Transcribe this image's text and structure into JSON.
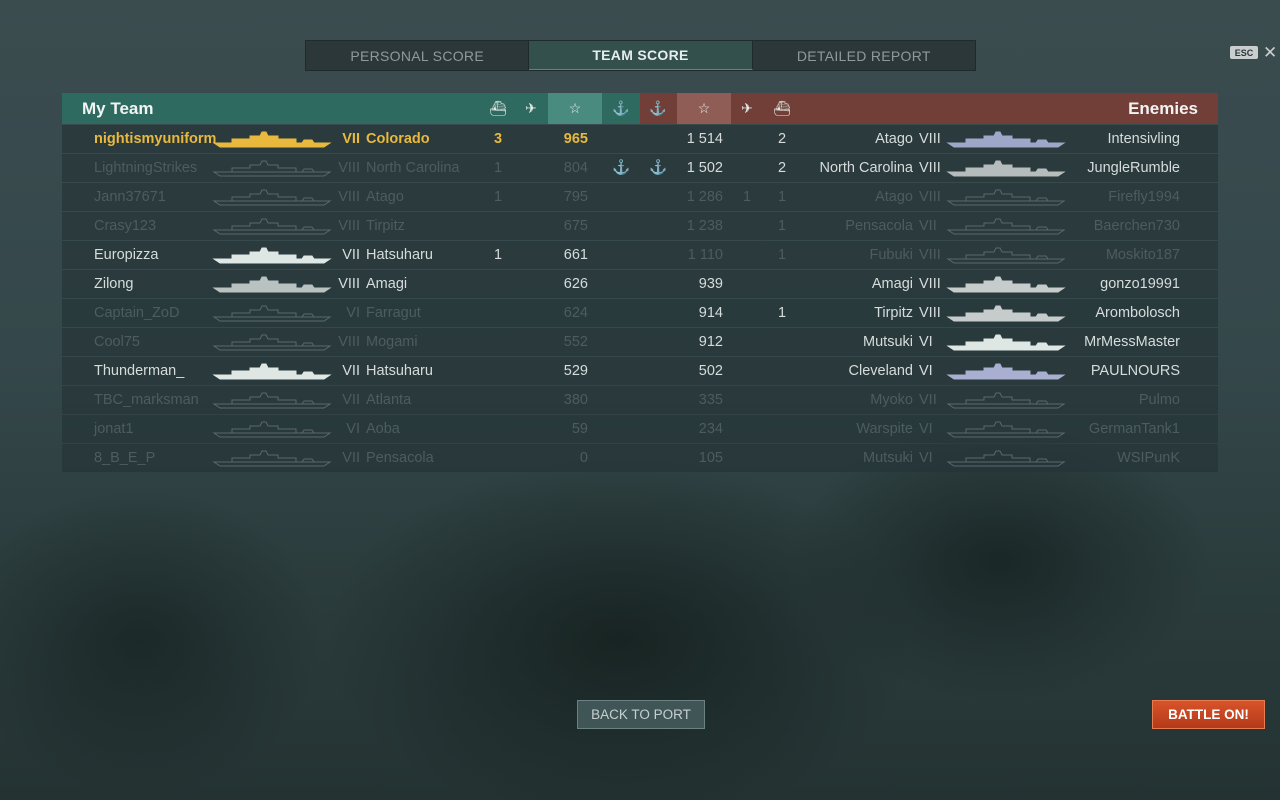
{
  "tabs": [
    "PERSONAL SCORE",
    "TEAM SCORE",
    "DETAILED REPORT"
  ],
  "active_tab": "TEAM SCORE",
  "esc_label": "ESC",
  "close_glyph": "✕",
  "my_team": {
    "title": "My Team",
    "header_icons": [
      "ship-sunk-icon",
      "planes-destroyed-icon",
      "star-icon",
      "anchor-icon"
    ],
    "header_glyphs": {
      "ship": "⛴",
      "planes": "✈",
      "star": "☆",
      "anchor": "⚓"
    },
    "sorted_column": "star",
    "rows": [
      {
        "player": "nightismyuniform",
        "tier": "VII",
        "ship": "Colorado",
        "kills": "3",
        "planes": "",
        "score": "965",
        "base": "",
        "state": "me",
        "ship_color": "#e8b93d"
      },
      {
        "player": "LightningStrikes",
        "tier": "VIII",
        "ship": "North Carolina",
        "kills": "1",
        "planes": "",
        "score": "804",
        "base": "⚓",
        "state": "dim",
        "ship_color": "#5a696b"
      },
      {
        "player": "Jann37671",
        "tier": "VIII",
        "ship": "Atago",
        "kills": "1",
        "planes": "",
        "score": "795",
        "base": "",
        "state": "dim",
        "ship_color": "#5a696b"
      },
      {
        "player": "Crasy123",
        "tier": "VIII",
        "ship": "Tirpitz",
        "kills": "",
        "planes": "",
        "score": "675",
        "base": "",
        "state": "dim",
        "ship_color": "#5a696b"
      },
      {
        "player": "Europizza",
        "tier": "VII",
        "ship": "Hatsuharu",
        "kills": "1",
        "planes": "",
        "score": "661",
        "base": "",
        "state": "alive",
        "ship_color": "#dfe7e4"
      },
      {
        "player": "Zilong",
        "tier": "VIII",
        "ship": "Amagi",
        "kills": "",
        "planes": "",
        "score": "626",
        "base": "",
        "state": "alive",
        "ship_color": "#b9c1c1"
      },
      {
        "player": "Captain_ZoD",
        "tier": "VI",
        "ship": "Farragut",
        "kills": "",
        "planes": "",
        "score": "624",
        "base": "",
        "state": "dim",
        "ship_color": "#5a696b"
      },
      {
        "player": "Cool75",
        "tier": "VIII",
        "ship": "Mogami",
        "kills": "",
        "planes": "",
        "score": "552",
        "base": "",
        "state": "dim",
        "ship_color": "#5a696b"
      },
      {
        "player": "Thunderman_",
        "tier": "VII",
        "ship": "Hatsuharu",
        "kills": "",
        "planes": "",
        "score": "529",
        "base": "",
        "state": "alive",
        "ship_color": "#dfe7e4"
      },
      {
        "player": "TBC_marksman",
        "tier": "VII",
        "ship": "Atlanta",
        "kills": "",
        "planes": "",
        "score": "380",
        "base": "",
        "state": "dim",
        "ship_color": "#5a696b"
      },
      {
        "player": "jonat1",
        "tier": "VI",
        "ship": "Aoba",
        "kills": "",
        "planes": "",
        "score": "59",
        "base": "",
        "state": "dim",
        "ship_color": "#5a696b"
      },
      {
        "player": "8_B_E_P",
        "tier": "VII",
        "ship": "Pensacola",
        "kills": "",
        "planes": "",
        "score": "0",
        "base": "",
        "state": "dim",
        "ship_color": "#5a696b"
      }
    ]
  },
  "enemies": {
    "title": "Enemies",
    "sorted_column": "star",
    "rows": [
      {
        "player": "Intensivling",
        "tier": "VIII",
        "ship": "Atago",
        "kills": "2",
        "planes": "",
        "score": "1 514",
        "base": "",
        "state": "alive",
        "ship_color": "#9ea7c8"
      },
      {
        "player": "JungleRumble",
        "tier": "VIII",
        "ship": "North Carolina",
        "kills": "2",
        "planes": "",
        "score": "1 502",
        "base": "⚓",
        "state": "alive",
        "ship_color": "#b5bcbb"
      },
      {
        "player": "Firefly1994",
        "tier": "VIII",
        "ship": "Atago",
        "kills": "1",
        "planes": "1",
        "score": "1 286",
        "base": "",
        "state": "dim",
        "ship_color": "#5a696b"
      },
      {
        "player": "Baerchen730",
        "tier": "VII",
        "ship": "Pensacola",
        "kills": "1",
        "planes": "",
        "score": "1 238",
        "base": "",
        "state": "dim",
        "ship_color": "#5a696b"
      },
      {
        "player": "Moskito187",
        "tier": "VIII",
        "ship": "Fubuki",
        "kills": "1",
        "planes": "",
        "score": "1 110",
        "base": "",
        "state": "dim",
        "ship_color": "#5a696b"
      },
      {
        "player": "gonzo19991",
        "tier": "VIII",
        "ship": "Amagi",
        "kills": "",
        "planes": "",
        "score": "939",
        "base": "",
        "state": "alive",
        "ship_color": "#c6cccc"
      },
      {
        "player": "Arombolosch",
        "tier": "VIII",
        "ship": "Tirpitz",
        "kills": "1",
        "planes": "",
        "score": "914",
        "base": "",
        "state": "alive",
        "ship_color": "#c6cccc"
      },
      {
        "player": "MrMessMaster",
        "tier": "VI",
        "ship": "Mutsuki",
        "kills": "",
        "planes": "",
        "score": "912",
        "base": "",
        "state": "alive",
        "ship_color": "#dfe7e4"
      },
      {
        "player": "PAULNOURS",
        "tier": "VI",
        "ship": "Cleveland",
        "kills": "",
        "planes": "",
        "score": "502",
        "base": "",
        "state": "alive",
        "ship_color": "#a8afd0"
      },
      {
        "player": "Pulmo",
        "tier": "VII",
        "ship": "Myoko",
        "kills": "",
        "planes": "",
        "score": "335",
        "base": "",
        "state": "dim",
        "ship_color": "#5a696b"
      },
      {
        "player": "GermanTank1",
        "tier": "VI",
        "ship": "Warspite",
        "kills": "",
        "planes": "",
        "score": "234",
        "base": "",
        "state": "dim",
        "ship_color": "#5a696b"
      },
      {
        "player": "WSIPunK",
        "tier": "VI",
        "ship": "Mutsuki",
        "kills": "",
        "planes": "",
        "score": "105",
        "base": "",
        "state": "dim",
        "ship_color": "#5a696b"
      }
    ]
  },
  "buttons": {
    "back": "BACK TO PORT",
    "battle": "BATTLE ON!"
  }
}
